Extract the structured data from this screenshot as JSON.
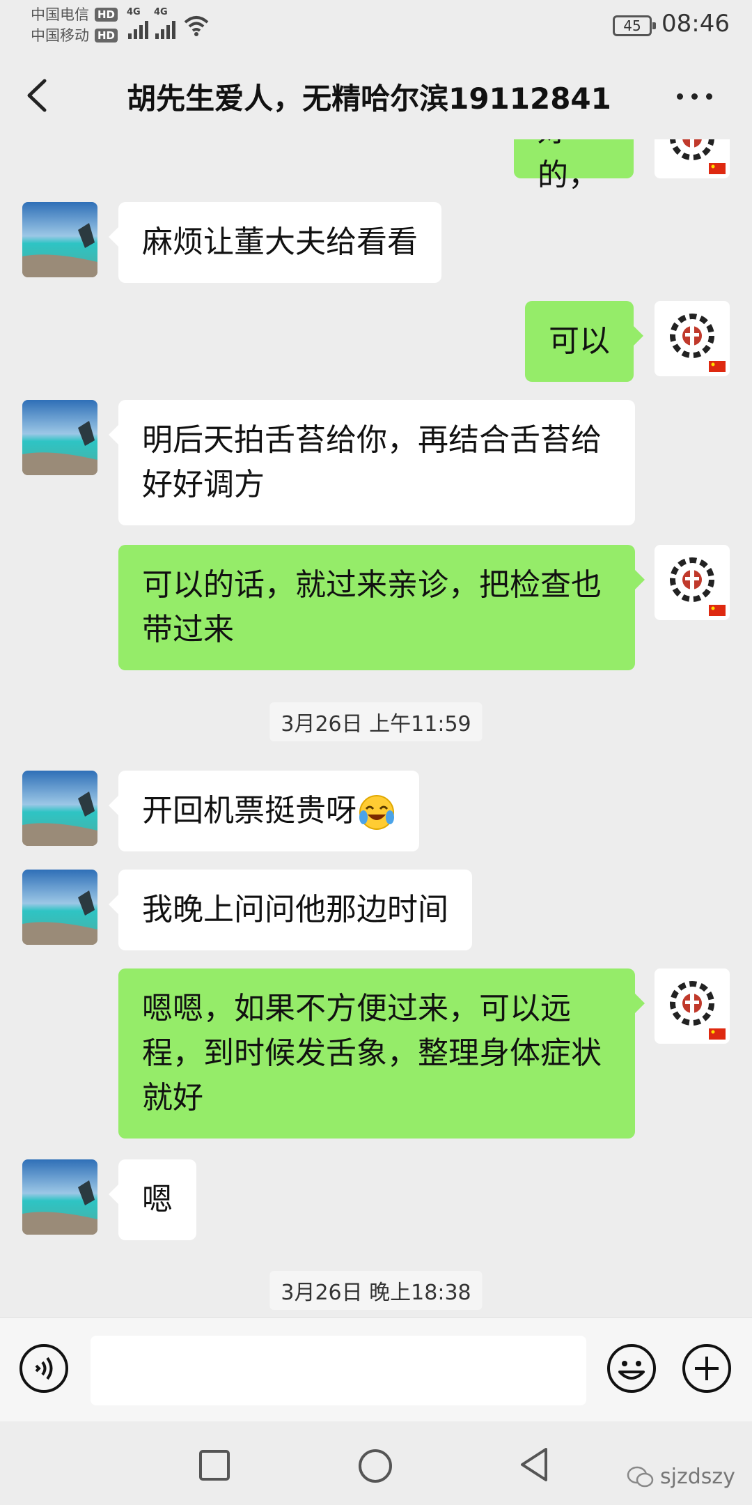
{
  "status_bar": {
    "carrier_1": "中国电信",
    "carrier_2": "中国移动",
    "hd_label": "HD",
    "network_1": "4G",
    "network_2": "4G",
    "battery": "45",
    "time": "08:46"
  },
  "header": {
    "title": "胡先生爱人，无精哈尔滨19112841"
  },
  "messages": [
    {
      "side": "right",
      "text": "好的，"
    },
    {
      "side": "left",
      "text": "麻烦让董大夫给看看"
    },
    {
      "side": "right",
      "text": "可以"
    },
    {
      "side": "left",
      "text": "明后天拍舌苔给你，再结合舌苔给好好调方"
    },
    {
      "side": "right",
      "text": "可以的话，就过来亲诊，把检查也带过来"
    },
    {
      "type": "timestamp",
      "text": "3月26日 上午11:59"
    },
    {
      "side": "left",
      "text": "开回机票挺贵呀",
      "emoji": "crying-laughing-face"
    },
    {
      "side": "left",
      "text": "我晚上问问他那边时间"
    },
    {
      "side": "right",
      "text": "嗯嗯，如果不方便过来，可以远程，到时候发舌象，整理身体症状就好"
    },
    {
      "side": "left",
      "text": "嗯"
    },
    {
      "type": "timestamp",
      "text": "3月26日 晚上18:38"
    }
  ],
  "input_bar": {
    "voice_icon": "voice-icon",
    "emoji_icon": "smiley-icon",
    "plus_icon": "plus-icon",
    "text_value": ""
  },
  "nav": {
    "watermark": "sjzdszy"
  },
  "colors": {
    "background": "#ededed",
    "bubble_green": "#95ec69",
    "bubble_white": "#ffffff"
  }
}
